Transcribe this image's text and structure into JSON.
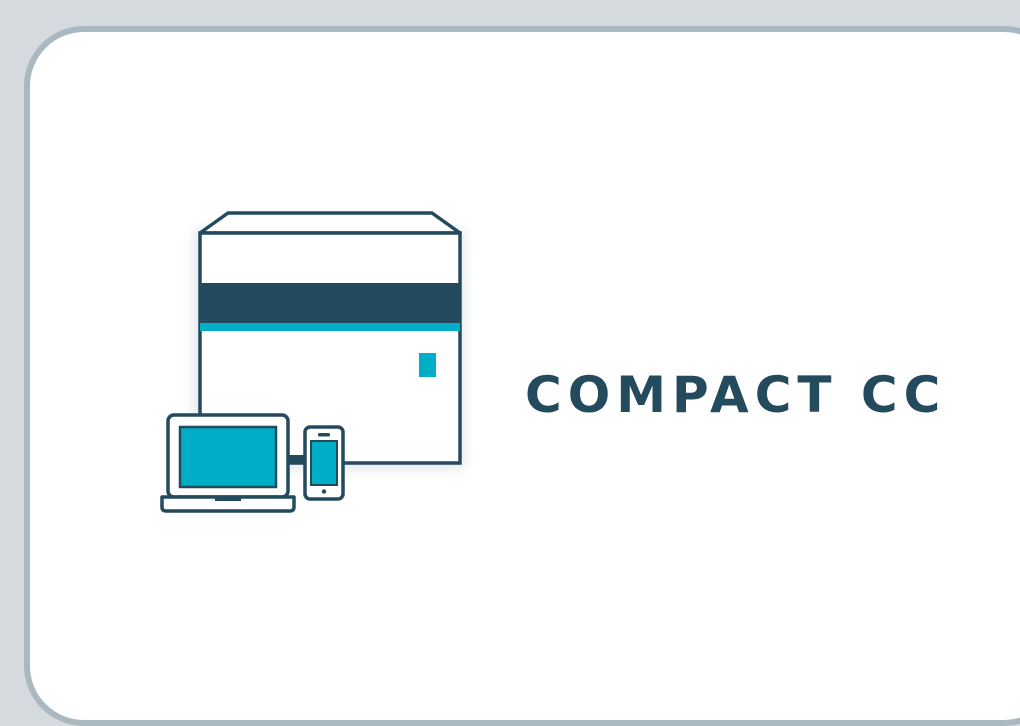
{
  "product": {
    "title": "COMPACT CC",
    "illustration_icon": "device-box-with-laptop-and-phone-icon"
  },
  "colors": {
    "background": "#d4dade",
    "card_border": "#aab8c1",
    "dark_navy": "#244a5e",
    "accent_cyan": "#00aec8",
    "card_fill": "#ffffff"
  }
}
